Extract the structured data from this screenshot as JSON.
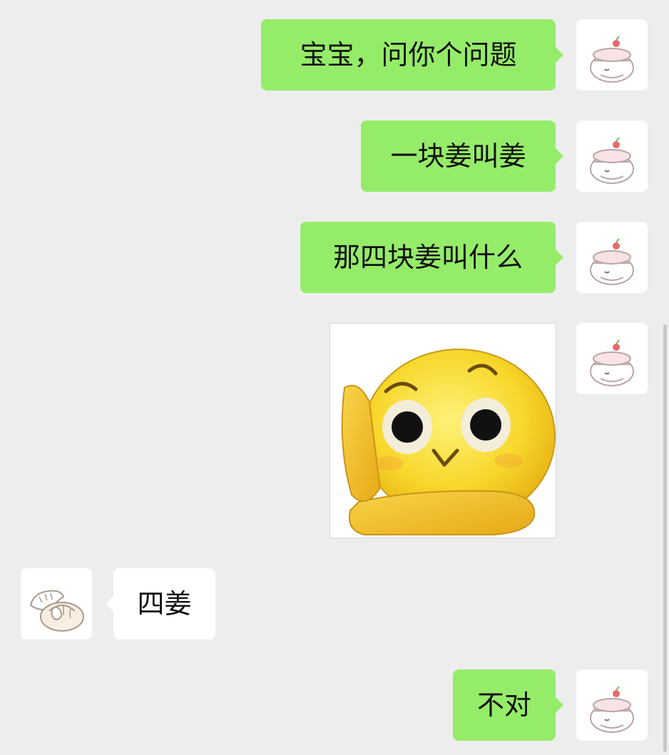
{
  "chat": {
    "messages": [
      {
        "sender": "me",
        "type": "text",
        "text": "宝宝，问你个问题"
      },
      {
        "sender": "me",
        "type": "text",
        "text": "一块姜叫姜"
      },
      {
        "sender": "me",
        "type": "text",
        "text": "那四块姜叫什么"
      },
      {
        "sender": "me",
        "type": "sticker",
        "sticker_icon": "shy-peeking-emoji-icon"
      },
      {
        "sender": "other",
        "type": "text",
        "text": "四姜"
      },
      {
        "sender": "me",
        "type": "text",
        "text": "不对"
      }
    ],
    "my_avatar_icon": "cake-character-avatar-icon",
    "other_avatar_icon": "steamed-bun-avatar-icon"
  },
  "colors": {
    "background": "#ededed",
    "my_bubble": "#95ec69",
    "other_bubble": "#ffffff",
    "text": "#111111"
  }
}
